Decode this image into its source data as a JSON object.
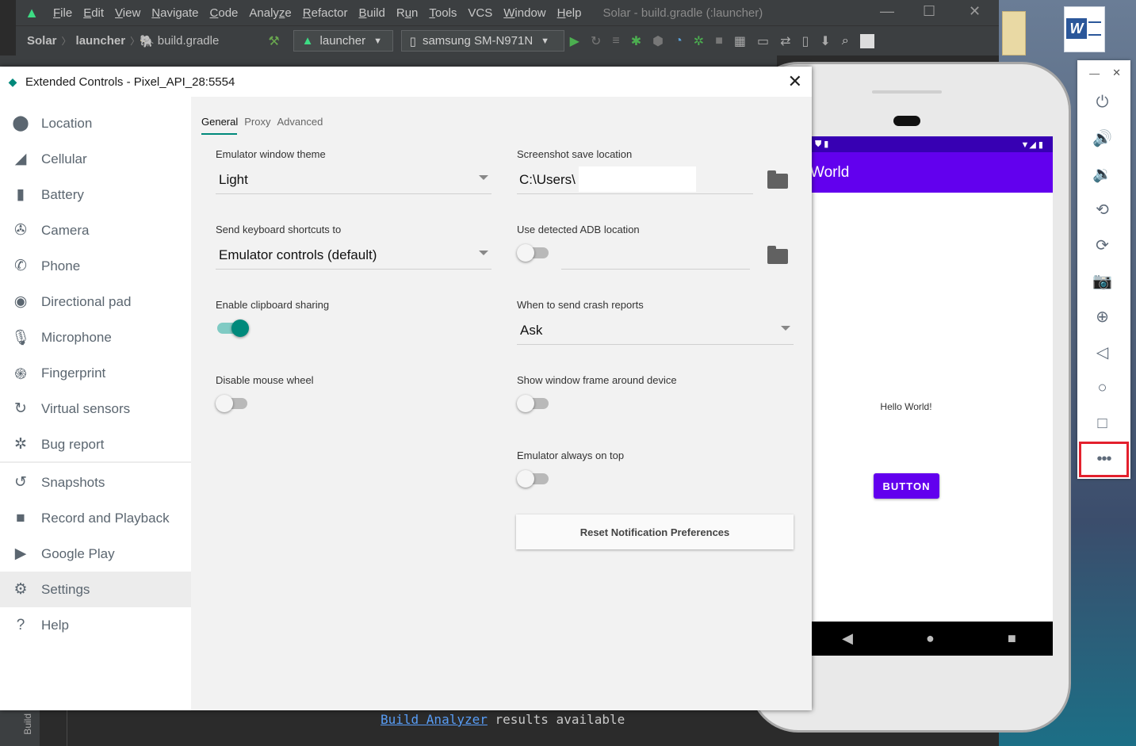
{
  "ide": {
    "menu": [
      {
        "pre": "",
        "u": "F",
        "post": "ile"
      },
      {
        "pre": "",
        "u": "E",
        "post": "dit"
      },
      {
        "pre": "",
        "u": "V",
        "post": "iew"
      },
      {
        "pre": "",
        "u": "N",
        "post": "avigate"
      },
      {
        "pre": "",
        "u": "C",
        "post": "ode"
      },
      {
        "pre": "Analy",
        "u": "z",
        "post": "e"
      },
      {
        "pre": "",
        "u": "R",
        "post": "efactor"
      },
      {
        "pre": "",
        "u": "B",
        "post": "uild"
      },
      {
        "pre": "R",
        "u": "u",
        "post": "n"
      },
      {
        "pre": "",
        "u": "T",
        "post": "ools"
      },
      {
        "pre": "VCS",
        "u": "",
        "post": ""
      },
      {
        "pre": "",
        "u": "W",
        "post": "indow"
      },
      {
        "pre": "",
        "u": "H",
        "post": "elp"
      }
    ],
    "window_title": "Solar - build.gradle (:launcher)",
    "breadcrumb": {
      "project": "Solar",
      "module": "launcher",
      "file": "build.gradle"
    },
    "run_config": "launcher",
    "device": "samsung SM-N971N",
    "bottom_tool_label": "Build",
    "build_link": "Build Analyzer",
    "build_message": " results available"
  },
  "emulator_phone": {
    "app_title": "World",
    "hello_text": "Hello World!",
    "button_label": "BUTTON"
  },
  "extended_controls": {
    "title": "Extended Controls - Pixel_API_28:5554",
    "sidebar": [
      {
        "label": "Location",
        "icon": "location-pin-icon",
        "glyph": "⬤"
      },
      {
        "label": "Cellular",
        "icon": "cellular-signal-icon",
        "glyph": "◢"
      },
      {
        "label": "Battery",
        "icon": "battery-icon",
        "glyph": "▮"
      },
      {
        "label": "Camera",
        "icon": "camera-aperture-icon",
        "glyph": "✇"
      },
      {
        "label": "Phone",
        "icon": "phone-icon",
        "glyph": "✆"
      },
      {
        "label": "Directional pad",
        "icon": "dpad-icon",
        "glyph": "◉"
      },
      {
        "label": "Microphone",
        "icon": "microphone-icon",
        "glyph": "🎙"
      },
      {
        "label": "Fingerprint",
        "icon": "fingerprint-icon",
        "glyph": "֍"
      },
      {
        "label": "Virtual sensors",
        "icon": "virtual-sensors-icon",
        "glyph": "↻"
      },
      {
        "label": "Bug report",
        "icon": "bug-icon",
        "glyph": "✲"
      },
      {
        "label": "Snapshots",
        "icon": "snapshots-history-icon",
        "glyph": "↺"
      },
      {
        "label": "Record and Playback",
        "icon": "video-camera-icon",
        "glyph": "■"
      },
      {
        "label": "Google Play",
        "icon": "google-play-icon",
        "glyph": "▶"
      },
      {
        "label": "Settings",
        "icon": "gear-icon",
        "glyph": "⚙"
      },
      {
        "label": "Help",
        "icon": "help-icon",
        "glyph": "?"
      }
    ],
    "tabs": [
      "General",
      "Proxy",
      "Advanced"
    ],
    "settings": {
      "theme_label": "Emulator window theme",
      "theme_value": "Light",
      "screenshot_label": "Screenshot save location",
      "screenshot_value": "C:\\Users\\",
      "shortcuts_label": "Send keyboard shortcuts to",
      "shortcuts_value": "Emulator controls (default)",
      "adb_label": "Use detected ADB location",
      "clipboard_label": "Enable clipboard sharing",
      "crash_label": "When to send crash reports",
      "crash_value": "Ask",
      "mouse_label": "Disable mouse wheel",
      "frame_label": "Show window frame around device",
      "ontop_label": "Emulator always on top",
      "reset_label": "Reset Notification Preferences"
    },
    "toggles": {
      "use_detected_adb": false,
      "enable_clipboard_sharing": true,
      "disable_mouse_wheel": false,
      "show_window_frame": false,
      "always_on_top": false
    }
  },
  "emulator_toolbar": [
    {
      "name": "power-icon",
      "glyph": "⏻"
    },
    {
      "name": "volume-up-icon",
      "glyph": "🔊"
    },
    {
      "name": "volume-down-icon",
      "glyph": "🔉"
    },
    {
      "name": "rotate-left-icon",
      "glyph": "⟲"
    },
    {
      "name": "rotate-right-icon",
      "glyph": "⟳"
    },
    {
      "name": "screenshot-camera-icon",
      "glyph": "📷"
    },
    {
      "name": "zoom-icon",
      "glyph": "⊕"
    },
    {
      "name": "back-icon",
      "glyph": "◁"
    },
    {
      "name": "home-icon",
      "glyph": "○"
    },
    {
      "name": "overview-icon",
      "glyph": "□"
    },
    {
      "name": "more-icon",
      "glyph": "•••"
    }
  ],
  "colors": {
    "accent_teal": "#00897b",
    "app_primary": "#6200ee",
    "highlight_red": "#e3202d"
  }
}
